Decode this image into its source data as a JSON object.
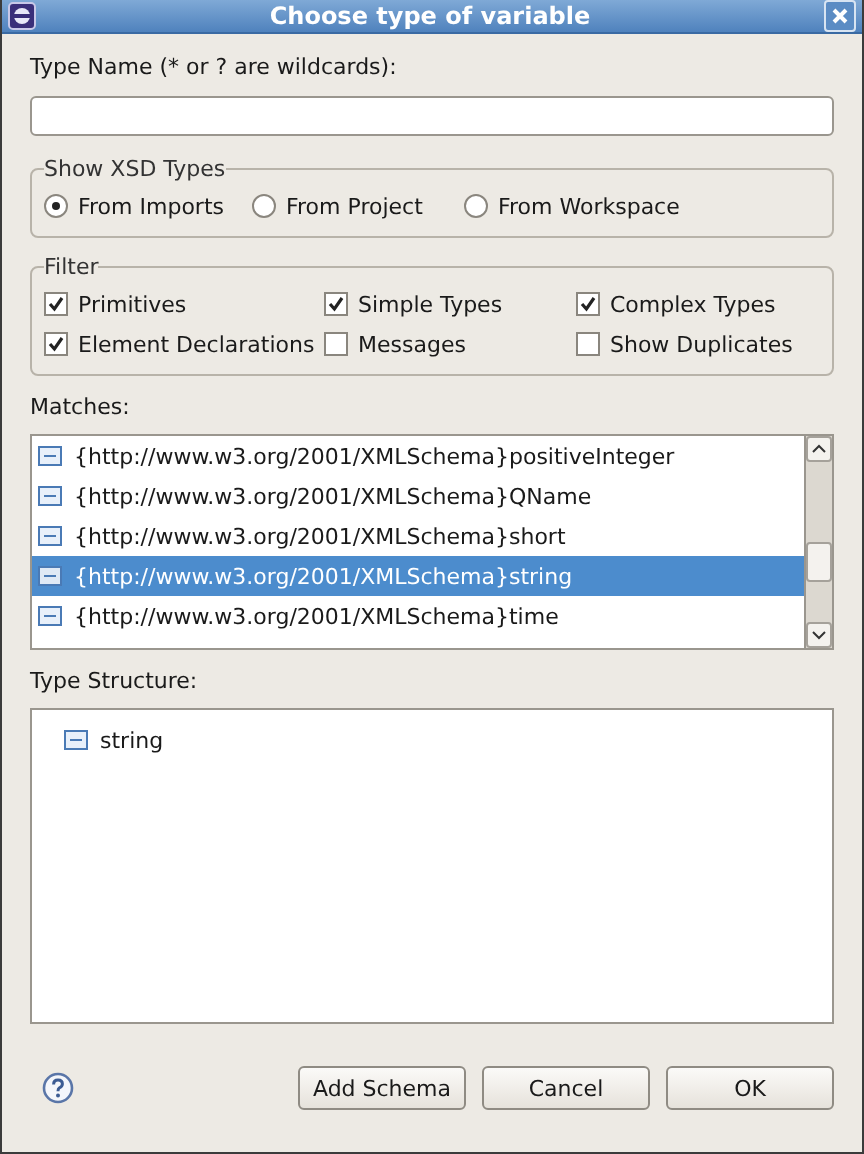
{
  "window": {
    "title": "Choose type of variable"
  },
  "type_name": {
    "label": "Type Name (* or ? are wildcards):"
  },
  "show_xsd_types": {
    "title": "Show XSD Types",
    "options": [
      {
        "label": "From Imports",
        "selected": true
      },
      {
        "label": "From Project",
        "selected": false
      },
      {
        "label": "From Workspace",
        "selected": false
      }
    ]
  },
  "filter": {
    "title": "Filter",
    "options": [
      {
        "label": "Primitives",
        "checked": true
      },
      {
        "label": "Simple Types",
        "checked": true
      },
      {
        "label": "Complex Types",
        "checked": true
      },
      {
        "label": "Element Declarations",
        "checked": true
      },
      {
        "label": "Messages",
        "checked": false
      },
      {
        "label": "Show Duplicates",
        "checked": false
      }
    ]
  },
  "matches": {
    "label": "Matches:",
    "items": [
      {
        "text": "{http://www.w3.org/2001/XMLSchema}positiveInteger",
        "selected": false
      },
      {
        "text": "{http://www.w3.org/2001/XMLSchema}QName",
        "selected": false
      },
      {
        "text": "{http://www.w3.org/2001/XMLSchema}short",
        "selected": false
      },
      {
        "text": "{http://www.w3.org/2001/XMLSchema}string",
        "selected": true
      },
      {
        "text": "{http://www.w3.org/2001/XMLSchema}time",
        "selected": false
      }
    ]
  },
  "type_structure": {
    "label": "Type Structure:",
    "items": [
      {
        "text": "string"
      }
    ]
  },
  "buttons": [
    {
      "label": "Add Schema",
      "default": false
    },
    {
      "label": "Cancel",
      "default": false
    },
    {
      "label": "OK",
      "default": false
    }
  ]
}
